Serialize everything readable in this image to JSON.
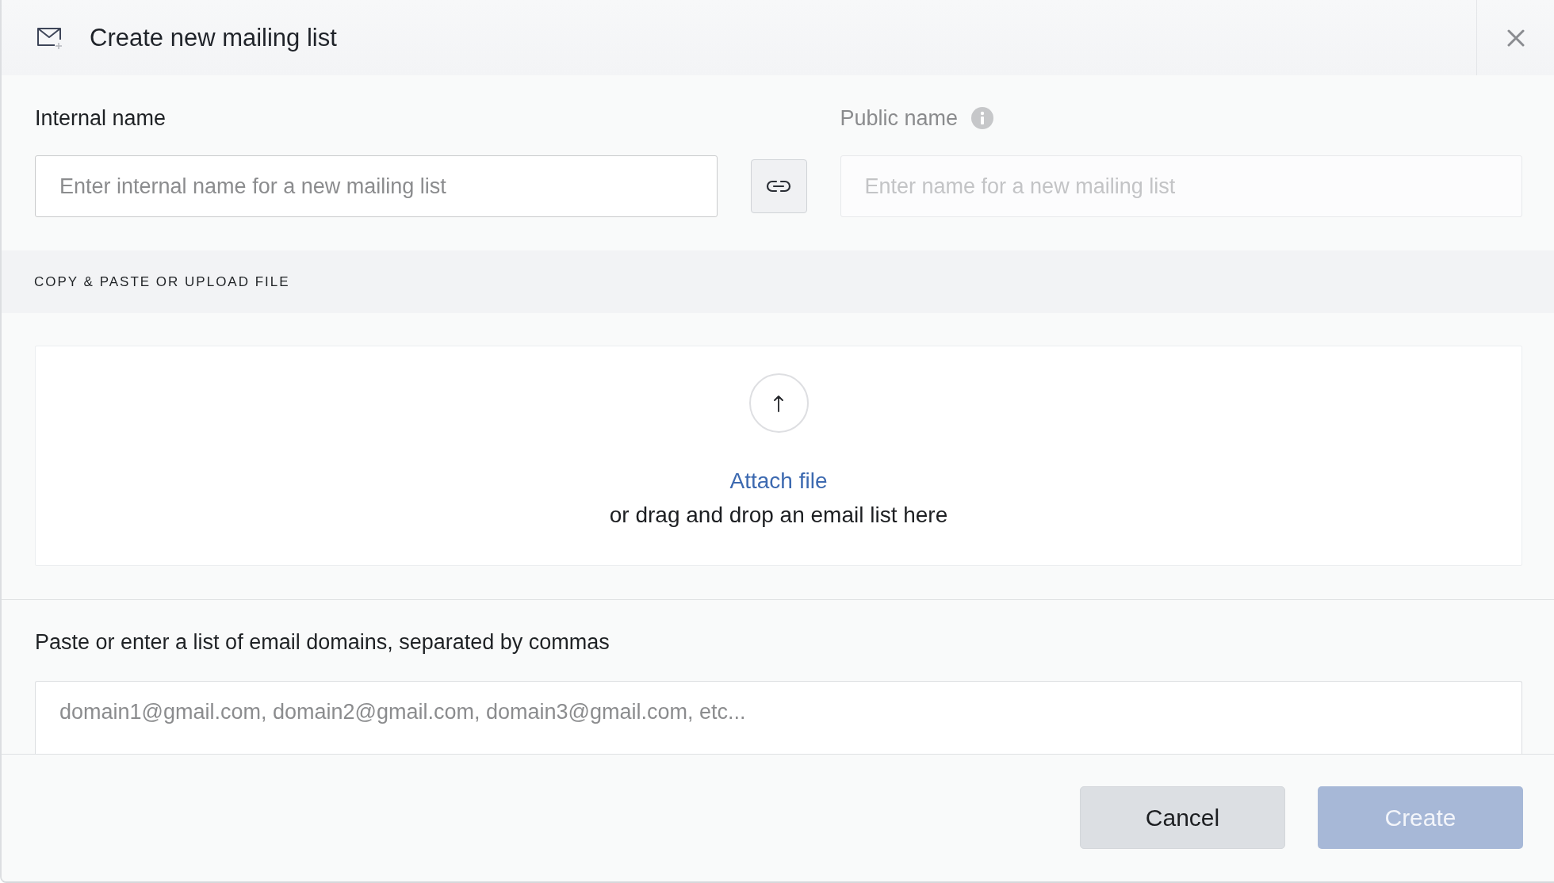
{
  "dialog": {
    "title": "Create new mailing list"
  },
  "name_fields": [
    {
      "label": "Internal name",
      "placeholder": "Enter internal name for a new mailing list",
      "disabled": false,
      "info": false
    },
    {
      "label": "Public name",
      "placeholder": "Enter name for a new mailing list",
      "disabled": true,
      "info": true
    }
  ],
  "upload": {
    "heading": "COPY & PASTE OR UPLOAD FILE",
    "link": "Attach file",
    "hint": "or drag and drop an email list here"
  },
  "domains": {
    "label": "Paste or enter a list of email domains, separated by commas",
    "placeholder": "domain1@gmail.com, domain2@gmail.com, domain3@gmail.com, etc..."
  },
  "buttons": [
    {
      "label": "Cancel",
      "kind": "secondary",
      "disabled": false
    },
    {
      "label": "Create",
      "kind": "primary",
      "disabled": true
    }
  ]
}
